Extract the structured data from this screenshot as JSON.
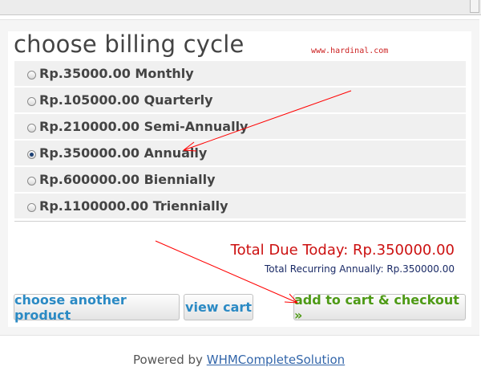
{
  "page": {
    "title": "choose billing cycle",
    "watermark": "www.hardinal.com"
  },
  "billing_options": [
    {
      "label": "Rp.35000.00 Monthly",
      "checked": false
    },
    {
      "label": "Rp.105000.00 Quarterly",
      "checked": false
    },
    {
      "label": "Rp.210000.00 Semi-Annually",
      "checked": false
    },
    {
      "label": "Rp.350000.00 Annually",
      "checked": true
    },
    {
      "label": "Rp.600000.00 Biennially",
      "checked": false
    },
    {
      "label": "Rp.1100000.00 Triennially",
      "checked": false
    }
  ],
  "totals": {
    "due_today": "Total Due Today: Rp.350000.00",
    "recurring": "Total Recurring Annually: Rp.350000.00"
  },
  "buttons": {
    "choose_another": "choose another product",
    "view_cart": "view cart",
    "checkout": "add to cart & checkout »"
  },
  "footer": {
    "powered_by": "Powered by",
    "link": "WHMCompleteSolution"
  },
  "colors": {
    "annotation": "#ff0000",
    "total_due": "#cc1111",
    "link_blue": "#2b8ac4",
    "checkout_green": "#4e9a16"
  }
}
